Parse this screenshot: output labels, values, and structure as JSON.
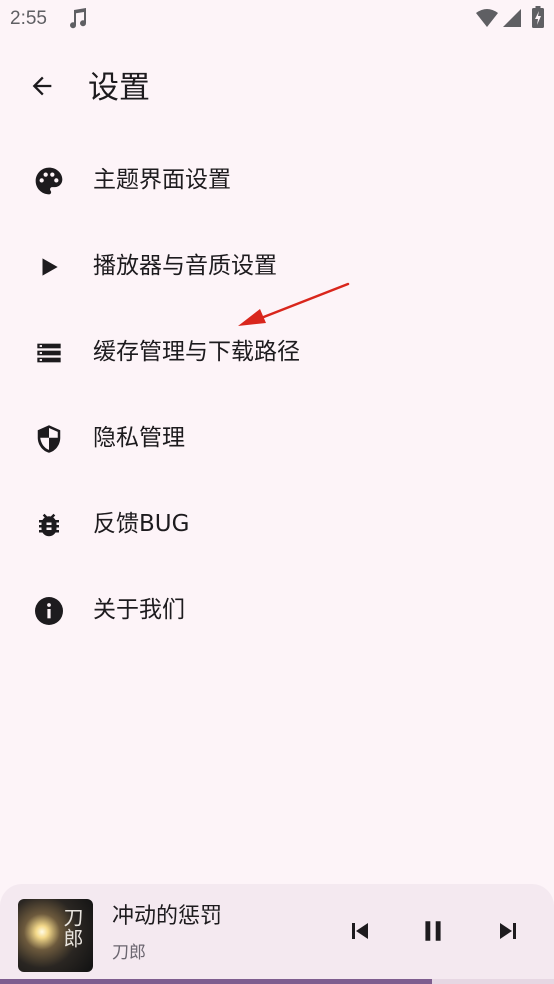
{
  "status_bar": {
    "time": "2:55",
    "icons": [
      "music-note-icon",
      "wifi-icon",
      "cell-signal-icon",
      "battery-charging-icon"
    ]
  },
  "header": {
    "title": "设置",
    "back_icon": "arrow-left-icon"
  },
  "menu": {
    "items": [
      {
        "label": "主题界面设置",
        "icon": "palette-icon"
      },
      {
        "label": "播放器与音质设置",
        "icon": "play-icon"
      },
      {
        "label": "缓存管理与下载路径",
        "icon": "storage-icon"
      },
      {
        "label": "隐私管理",
        "icon": "shield-icon"
      },
      {
        "label": "反馈BUG",
        "icon": "bug-icon"
      },
      {
        "label": "关于我们",
        "icon": "info-icon"
      }
    ]
  },
  "annotation": {
    "icon": "red-arrow-icon",
    "color": "#d9261c"
  },
  "player": {
    "song_title": "冲动的惩罚",
    "artist": "刀郎",
    "album_art_text": "刀郎",
    "progress": 0.78,
    "controls": [
      "skip-previous-icon",
      "pause-icon",
      "skip-next-icon"
    ]
  },
  "colors": {
    "background": "#fdf4f8",
    "player_background": "#f4e9f0",
    "progress_fill": "#7e5d8f",
    "icon": "#1d1b1e"
  }
}
